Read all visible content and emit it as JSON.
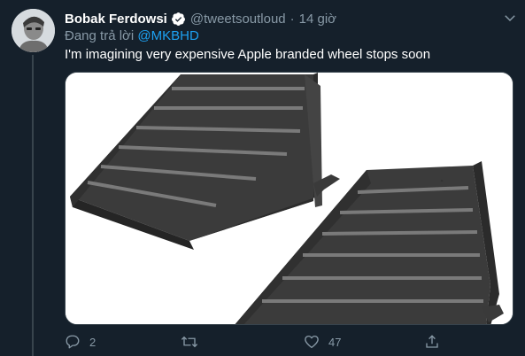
{
  "author": {
    "name": "Bobak Ferdowsi",
    "handle": "@tweetsoutloud",
    "separator": "·",
    "time": "14 giờ",
    "avatar_icon": "avatar-portrait"
  },
  "reply": {
    "prefix": "Đang trả lời ",
    "mention": "@MKBHD"
  },
  "text": "I'm imagining very expensive Apple branded wheel stops soon",
  "media": {
    "icon": "wheel-chocks-photo"
  },
  "actions": {
    "reply_count": "2",
    "retweet_count": "",
    "like_count": "47"
  },
  "colors": {
    "background": "#15202b",
    "text": "#ffffff",
    "muted": "#8899a6",
    "accent": "#1da1f2",
    "border": "#38444d"
  }
}
